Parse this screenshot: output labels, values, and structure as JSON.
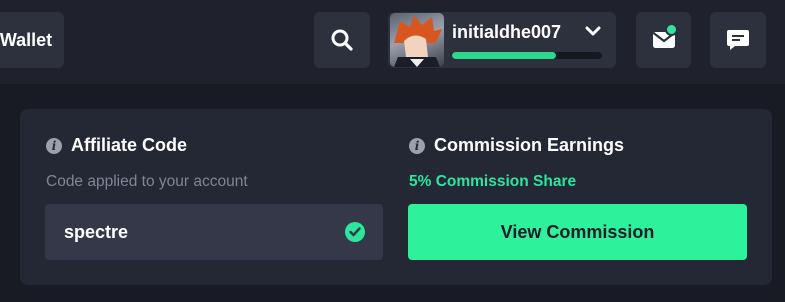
{
  "header": {
    "wallet_label": "Wallet",
    "user": {
      "username": "initialdhe007",
      "xp_progress": 0.69
    },
    "icons": {
      "search": "search-icon",
      "mail": "mail-icon",
      "chat": "chat-icon",
      "chevron": "chevron-down-icon"
    },
    "notification_color": "#2ee59d"
  },
  "affiliate": {
    "title": "Affiliate Code",
    "subtitle": "Code applied to your account",
    "code_value": "spectre"
  },
  "commission": {
    "title": "Commission Earnings",
    "share_text": "5% Commission Share",
    "button_label": "View Commission"
  },
  "colors": {
    "accent": "#2ef29b",
    "card_bg": "#242835",
    "page_bg": "#191b24"
  }
}
